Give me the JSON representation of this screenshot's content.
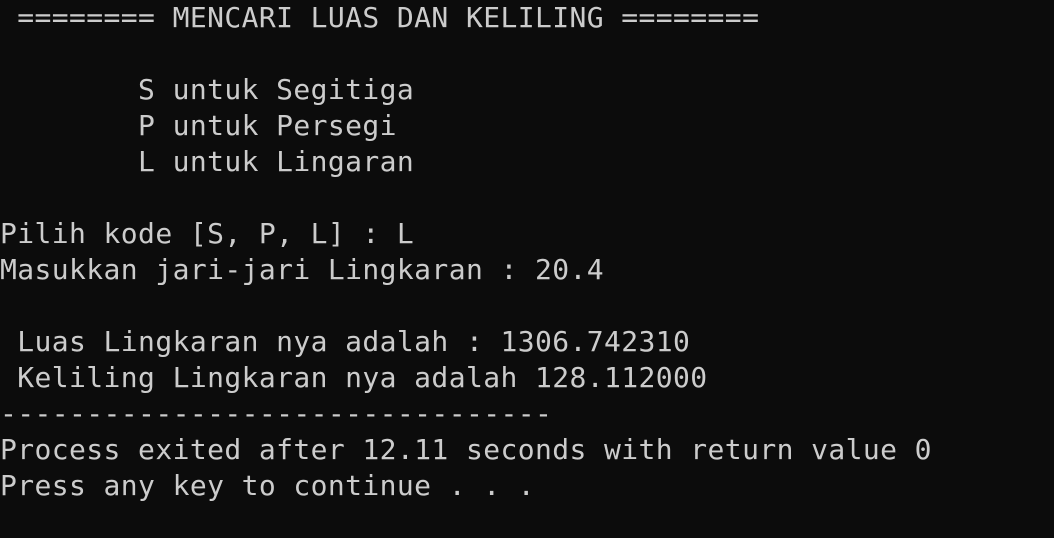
{
  "console": {
    "lines": [
      " ======== MENCARI LUAS DAN KELILING ========",
      "",
      "        S untuk Segitiga",
      "        P untuk Persegi",
      "        L untuk Lingaran",
      "",
      "Pilih kode [S, P, L] : L",
      "Masukkan jari-jari Lingkaran : 20.4",
      "",
      " Luas Lingkaran nya adalah : 1306.742310",
      " Keliling Lingkaran nya adalah 128.112000",
      "--------------------------------",
      "Process exited after 12.11 seconds with return value 0",
      "Press any key to continue . . ."
    ]
  },
  "colors": {
    "background": "#0c0c0c",
    "text": "#cccccc"
  }
}
